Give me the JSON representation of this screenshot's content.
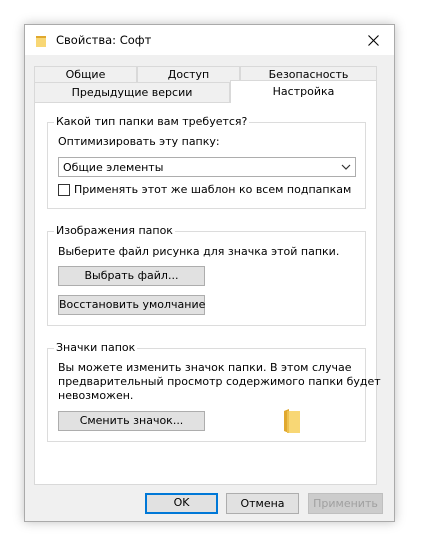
{
  "window": {
    "title": "Свойства: Софт"
  },
  "tabs": {
    "row1": [
      "Общие",
      "Доступ",
      "Безопасность"
    ],
    "row2": [
      "Предыдущие версии",
      "Настройка"
    ],
    "active": "Настройка"
  },
  "folder_type": {
    "caption": "Какой тип папки вам требуется?",
    "optimize_label": "Оптимизировать эту папку:",
    "selected_option": "Общие элементы",
    "apply_subfolders_label": "Применять этот же шаблон ко всем подпапкам",
    "apply_subfolders_checked": false
  },
  "folder_pictures": {
    "caption": "Изображения папок",
    "hint": "Выберите файл рисунка для значка этой папки.",
    "choose_file_button": "Выбрать файл...",
    "restore_default_button": "Восстановить умолчание"
  },
  "folder_icons": {
    "caption": "Значки папок",
    "description_lines": [
      "Вы можете изменить значок папки. В этом случае",
      "предварительный просмотр содержимого папки будет",
      "невозможен."
    ],
    "change_icon_button": "Сменить значок..."
  },
  "footer": {
    "ok": "OK",
    "cancel": "Отмена",
    "apply": "Применить"
  },
  "colors": {
    "folder_yellow": "#f8d775",
    "folder_dark": "#e0a82e",
    "accent": "#0078d7"
  }
}
